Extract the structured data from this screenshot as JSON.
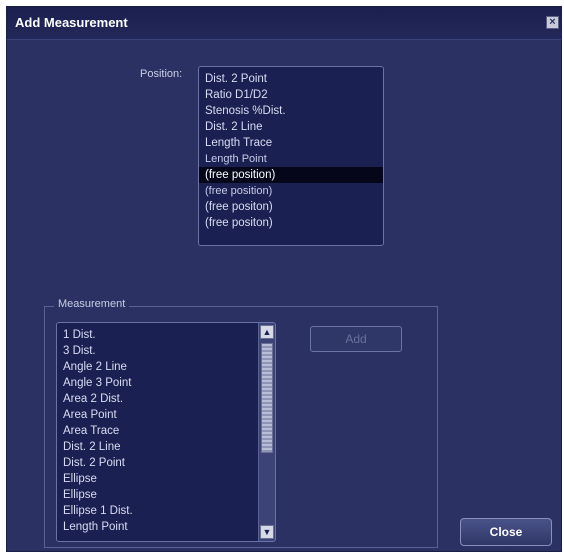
{
  "dialog": {
    "title": "Add Measurement",
    "close_icon": "close-icon"
  },
  "position": {
    "label": "Position:",
    "items": [
      {
        "label": "Dist. 2 Point"
      },
      {
        "label": "Ratio D1/D2"
      },
      {
        "label": "Stenosis %Dist."
      },
      {
        "label": "Dist. 2 Line"
      },
      {
        "label": "Length Trace"
      },
      {
        "label": "Length Point"
      },
      {
        "label": "(free position)",
        "selected": true
      },
      {
        "label": "(free position)"
      },
      {
        "label": "(free positon)"
      },
      {
        "label": "(free positon)"
      }
    ]
  },
  "measurement": {
    "legend": "Measurement",
    "items": [
      "1 Dist.",
      "3 Dist.",
      "Angle 2 Line",
      "Angle 3 Point",
      "Area 2 Dist.",
      "Area Point",
      "Area Trace",
      "Dist. 2 Line",
      "Dist. 2 Point",
      "Ellipse",
      "Ellipse",
      "Ellipse 1 Dist.",
      "Length Point"
    ],
    "add_label": "Add",
    "scroll_up_icon": "up-arrow-icon",
    "scroll_down_icon": "down-arrow-icon"
  },
  "footer": {
    "close_label": "Close"
  }
}
